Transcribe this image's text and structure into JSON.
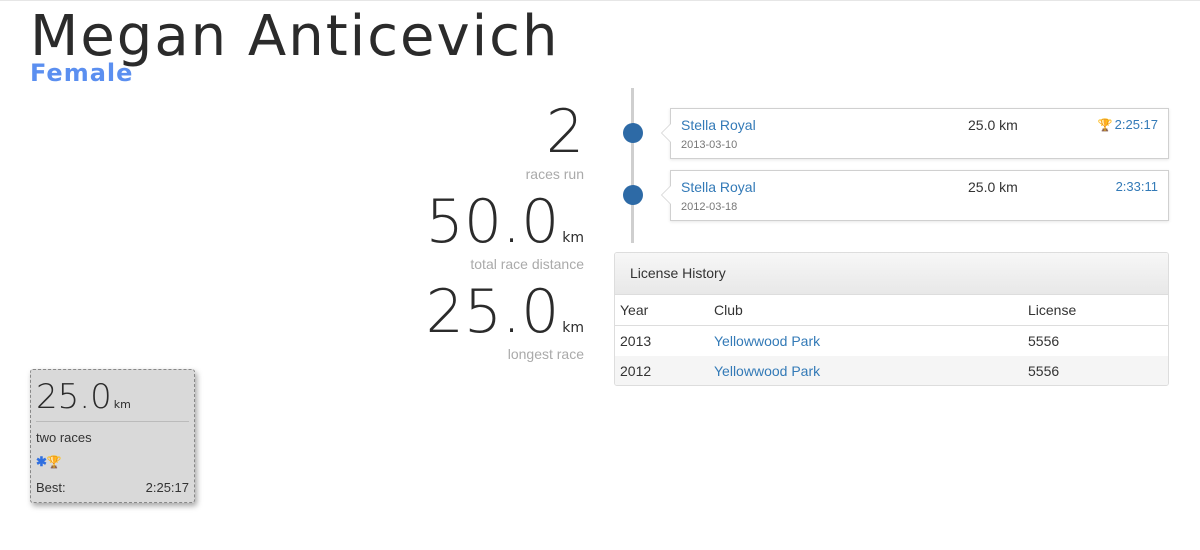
{
  "runner": {
    "name": "Megan Anticevich",
    "gender": "Female"
  },
  "stats": {
    "races": {
      "value": "2",
      "label": "races run"
    },
    "total_distance": {
      "value": "50.0",
      "unit": "km",
      "label": "total race distance"
    },
    "longest": {
      "value": "25.0",
      "unit": "km",
      "label": "longest race"
    }
  },
  "timeline": [
    {
      "race": "Stella Royal",
      "date": "2013-03-10",
      "distance": "25.0 km",
      "time": "2:25:17",
      "icon": "trophy-icon"
    },
    {
      "race": "Stella Royal",
      "date": "2012-03-18",
      "distance": "25.0 km",
      "time": "2:33:11"
    }
  ],
  "license_history": {
    "title": "License History",
    "columns": [
      "Year",
      "Club",
      "License"
    ],
    "rows": [
      {
        "year": "2013",
        "club": "Yellowwood Park",
        "license": "5556"
      },
      {
        "year": "2012",
        "club": "Yellowwood Park",
        "license": "5556"
      }
    ]
  },
  "summary_card": {
    "distance": "25.0",
    "unit": "km",
    "races": "two races",
    "icons": [
      "asterisk-icon",
      "trophy-icon"
    ],
    "best_label": "Best:",
    "best_time": "2:25:17"
  },
  "colors": {
    "accent": "#5b8ff0",
    "link": "#337ab7",
    "timeline_dot": "#2d6aa6",
    "trophy": "#d4a017"
  }
}
